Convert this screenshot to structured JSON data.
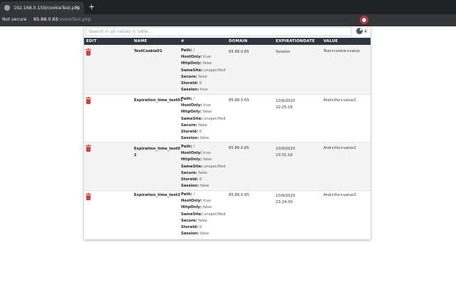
{
  "browser": {
    "tab_title": "192.168.0.150/cookieTest.php",
    "tab_close": "×",
    "new_tab": "+",
    "security_label": "Not secure",
    "url_host": "85.88.0.65",
    "url_path": "/cookieTest.php"
  },
  "search": {
    "placeholder": "Search in all values in table...",
    "count": "4"
  },
  "columns": {
    "edit": "EDIT",
    "name": "NAME",
    "hash": "#",
    "domain": "DOMAIN",
    "expiration": "EXPIRATIONDATE",
    "value": "VALUE"
  },
  "colors": {
    "header_bg": "#2e3740",
    "delete_icon": "#e53935",
    "chrome_bg": "#35363a"
  },
  "rows": [
    {
      "name": [
        "TestCookie01"
      ],
      "domain": "85.88.0.65",
      "expiration": [
        "Session"
      ],
      "value": "Test+cookie+value",
      "props": [
        {
          "k": "Path:",
          "v": " /"
        },
        {
          "k": "HostOnly:",
          "v": " true"
        },
        {
          "k": "HttpOnly:",
          "v": " false"
        },
        {
          "k": "SameSite:",
          "v": " unspecified"
        },
        {
          "k": "Secure:",
          "v": " false"
        },
        {
          "k": "StoreId:",
          "v": " 0"
        },
        {
          "k": "Session:",
          "v": " true"
        }
      ]
    },
    {
      "name": [
        "Expiration_time_test01"
      ],
      "domain": "85.88.0.65",
      "expiration": [
        "10/9/2020",
        "22:25:18"
      ],
      "value": "And+the+value1",
      "props": [
        {
          "k": "Path:",
          "v": " /"
        },
        {
          "k": "HostOnly:",
          "v": " true"
        },
        {
          "k": "HttpOnly:",
          "v": " false"
        },
        {
          "k": "SameSite:",
          "v": " unspecified"
        },
        {
          "k": "Secure:",
          "v": " false"
        },
        {
          "k": "StoreId:",
          "v": " 0"
        },
        {
          "k": "Session:",
          "v": " false"
        }
      ]
    },
    {
      "name": [
        "Expiration_time_test0",
        "2"
      ],
      "domain": "85.88.0.65",
      "expiration": [
        "10/9/2020",
        "23:01:18"
      ],
      "value": "And+the+value2",
      "props": [
        {
          "k": "Path:",
          "v": " /"
        },
        {
          "k": "HostOnly:",
          "v": " true"
        },
        {
          "k": "HttpOnly:",
          "v": " false"
        },
        {
          "k": "SameSite:",
          "v": " unspecified"
        },
        {
          "k": "Secure:",
          "v": " false"
        },
        {
          "k": "StoreId:",
          "v": " 0"
        },
        {
          "k": "Session:",
          "v": " false"
        }
      ]
    },
    {
      "name": [
        "Expiration_time_test3"
      ],
      "domain": "85.88.0.65",
      "expiration": [
        "10/9/2020",
        "23:24:30"
      ],
      "value": "And+the+value3",
      "props": [
        {
          "k": "Path:",
          "v": " /"
        },
        {
          "k": "HostOnly:",
          "v": " true"
        },
        {
          "k": "HttpOnly:",
          "v": " false"
        },
        {
          "k": "SameSite:",
          "v": " unspecified"
        },
        {
          "k": "Secure:",
          "v": " false"
        },
        {
          "k": "StoreId:",
          "v": " 0"
        },
        {
          "k": "Session:",
          "v": " false"
        }
      ]
    }
  ]
}
